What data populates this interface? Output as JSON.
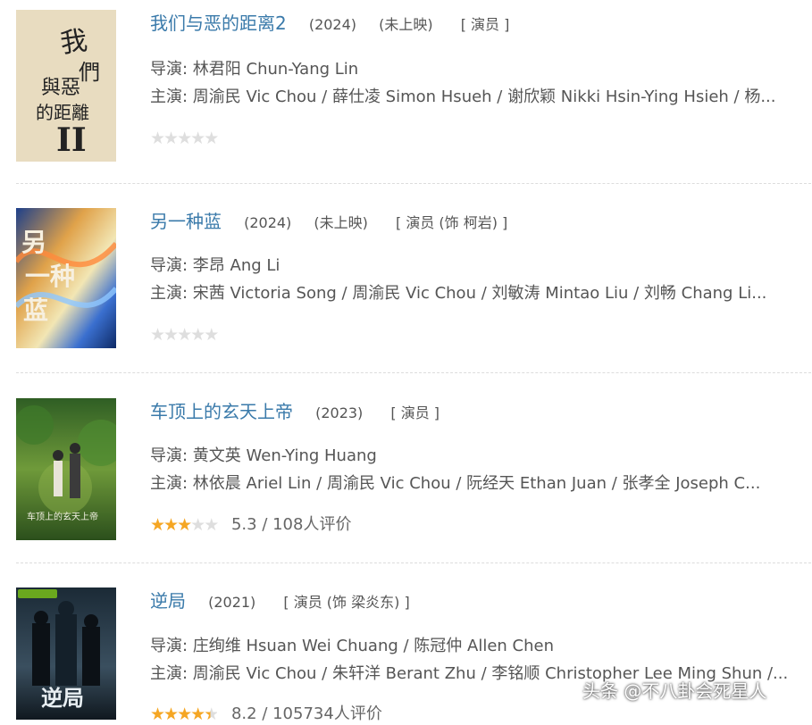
{
  "movies": [
    {
      "title": "我们与恶的距离2",
      "year": "(2024)",
      "status": "(未上映)",
      "role": "[ 演员 ]",
      "director": "导演: 林君阳 Chun-Yang Lin",
      "cast": "主演: 周渝民 Vic Chou / 薛仕凌 Simon Hsueh / 谢欣颖 Nikki Hsin-Ying Hsieh / 杨...",
      "rating": 0,
      "rating_text": "",
      "poster_text": "我們與惡的距離 II"
    },
    {
      "title": "另一种蓝",
      "year": "(2024)",
      "status": "(未上映)",
      "role": "[ 演员 (饰 柯岩) ]",
      "director": "导演: 李昂 Ang Li",
      "cast": "主演: 宋茜 Victoria Song / 周渝民 Vic Chou / 刘敏涛 Mintao Liu / 刘畅 Chang Li...",
      "rating": 0,
      "rating_text": "",
      "poster_text": "另一种蓝"
    },
    {
      "title": "车顶上的玄天上帝",
      "year": "(2023)",
      "status": "",
      "role": "[ 演员 ]",
      "director": "导演: 黄文英 Wen-Ying Huang",
      "cast": "主演: 林依晨 Ariel Lin / 周渝民 Vic Chou / 阮经天 Ethan Juan / 张孝全 Joseph C...",
      "rating": 3,
      "rating_text": "5.3 / 108人评价",
      "poster_text": "车顶上的玄天上帝"
    },
    {
      "title": "逆局",
      "year": "(2021)",
      "status": "",
      "role": "[ 演员 (饰 梁炎东) ]",
      "director": "导演: 庄绚维 Hsuan Wei Chuang / 陈冠仲 Allen Chen",
      "cast": "主演: 周渝民 Vic Chou / 朱轩洋 Berant Zhu / 李铭顺 Christopher Lee Ming Shun /...",
      "rating": 4.5,
      "rating_text": "8.2 / 105734人评价",
      "poster_text": "逆局"
    }
  ],
  "watermark": "头条 @不八卦会死星人",
  "colors": {
    "title": "#3a7aaa",
    "star_on": "#f5a623",
    "star_off": "#dedede"
  }
}
